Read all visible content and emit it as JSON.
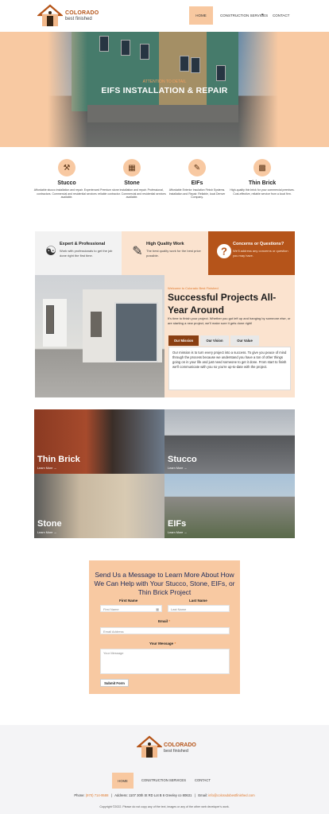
{
  "header": {
    "logo_line1": "COLORADO",
    "logo_line2": "best finished",
    "nav": {
      "home": "HOME",
      "construction": "CONSTRUCTION SERVICES",
      "contact": "CONTACT"
    }
  },
  "hero": {
    "small": "ATTENTION TO DETAIL",
    "title": "EIFS INSTALLATION & REPAIR"
  },
  "services": [
    {
      "title": "Stucco",
      "desc": "Affordable stucco installation and repair. Experienced contractors. Commercial and residential services available.",
      "icon": "trowel-icon"
    },
    {
      "title": "Stone",
      "desc": "Premium stone installation and repair. Professional, reliable contractor. Commercial and residential services available.",
      "icon": "stone-icon"
    },
    {
      "title": "EIFs",
      "desc": "Affordable Exterior Insulation Finish Systems. Installation and Repair. Reliable, local Denver Company.",
      "icon": "eifs-icon"
    },
    {
      "title": "Thin Brick",
      "desc": "High-quality thin brick for your commercial premises. Cost-effective, reliable service from a local firm.",
      "icon": "brick-icon"
    }
  ],
  "features": [
    {
      "title": "Expert & Professional",
      "desc": "Work with professionals to get the job done right the first time.",
      "icon": "expert-icon"
    },
    {
      "title": "High Quality Work",
      "desc": "The best quality work for the best price possible.",
      "icon": "quality-icon"
    },
    {
      "title": "Concerns or Questions?",
      "desc": "We'll address any concerns or question you may have.",
      "icon": "question-icon"
    }
  ],
  "about": {
    "small": "Welcome to Colorado Best Finished",
    "title": "Successful Projects All-Year Around",
    "paragraph": "It's time to finish your project. Whether you got left up and hanging by someone else, or are starting a new project, we'll make sure it gets done right!",
    "tabs": [
      "Our Mission",
      "Our Vision",
      "Our Value"
    ],
    "mission": "Our mission is to turn every project into a success. To give you peace of mind through the process because we understand you have a ton of other things going on in your life and just need someone to get it done. From start to finish we'll communicate with you so you're up-to-date with the project."
  },
  "grid": [
    {
      "title": "Thin Brick",
      "link": "Learn More →"
    },
    {
      "title": "Stucco",
      "link": "Learn More →"
    },
    {
      "title": "Stone",
      "link": "Learn More →"
    },
    {
      "title": "EIFs",
      "link": "Learn More →"
    }
  ],
  "form": {
    "title": "Send Us a Message to Learn More About How We Can Help with Your Stucco, Stone, EIFs, or Thin Brick Project",
    "first_label": "First Name",
    "last_label": "Last Name",
    "first_placeholder": "First Name",
    "last_placeholder": "Last Name",
    "email_label": "Email",
    "email_placeholder": "Email Address",
    "message_label": "Your Message",
    "message_placeholder": "Your Message",
    "submit": "Submit Form",
    "required_mark": "*"
  },
  "footer": {
    "nav": {
      "home": "HOME",
      "construction": "CONSTRUCTION SERVICES",
      "contact": "CONTACT"
    },
    "phone_label": "Phone:",
    "phone": "(970) 714-9588",
    "address_label": "Address:",
    "address": "1107 30th St RD Lot B 6 Greeley co 80631",
    "email_label": "Email:",
    "email": "info@coloradobestfinished.com",
    "copyright": "Copyright ©2022. Please do not copy any of the text, images or any of the other web developer's work."
  },
  "colors": {
    "accent": "#e07a2e",
    "peach": "#f8c9a2",
    "brown": "#b5541a"
  }
}
